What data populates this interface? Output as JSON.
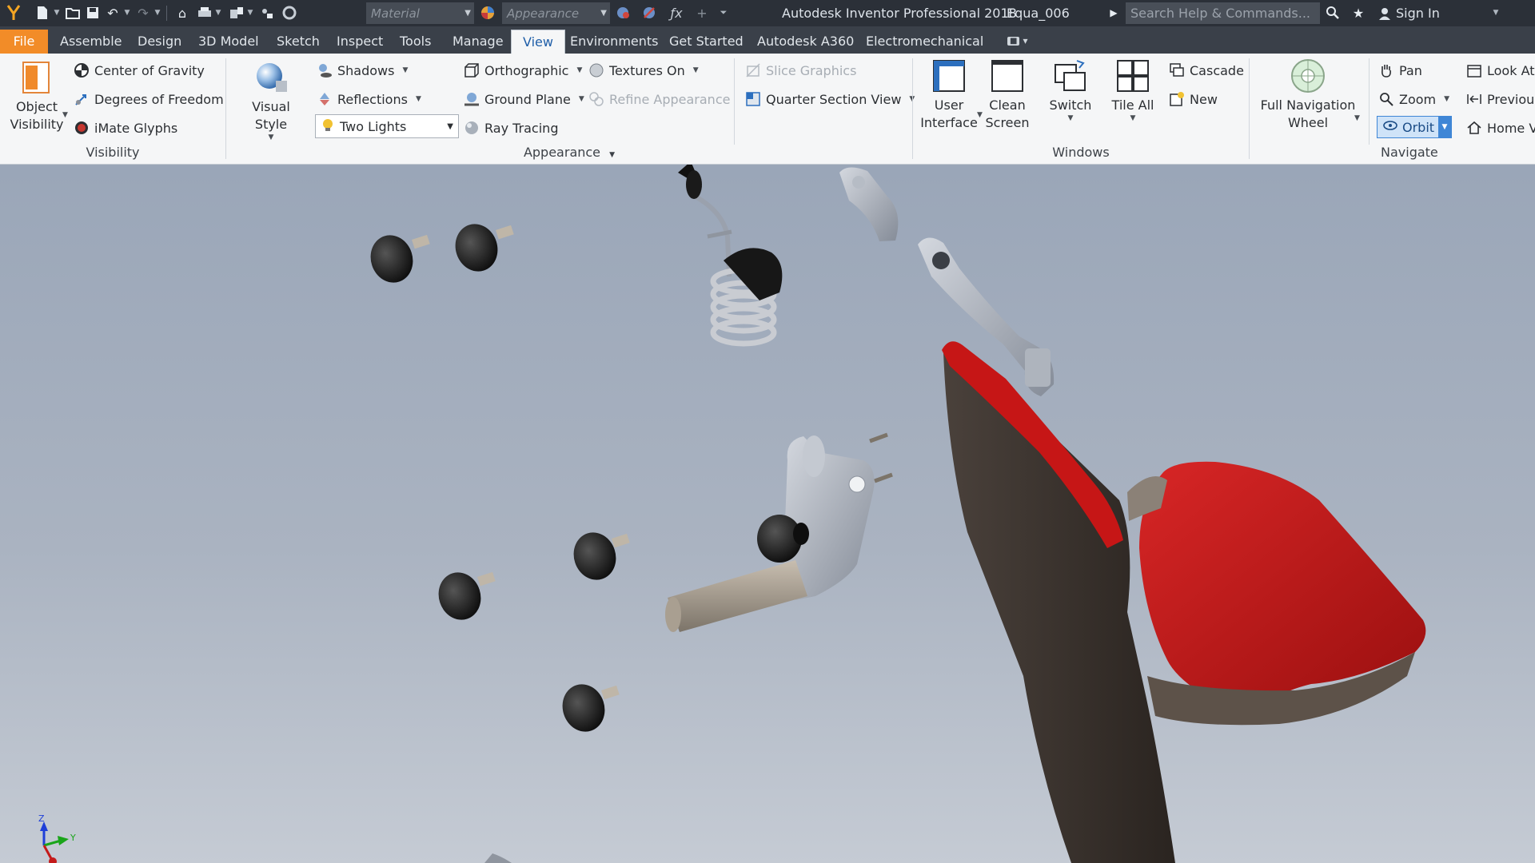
{
  "titlebar": {
    "app_title": "Autodesk Inventor Professional 2018",
    "document": "Equa_006",
    "material_placeholder": "Material",
    "appearance_placeholder": "Appearance",
    "search_placeholder": "Search Help & Commands...",
    "sign_in": "Sign In"
  },
  "tabs": [
    "File",
    "Assemble",
    "Design",
    "3D Model",
    "Sketch",
    "Inspect",
    "Tools",
    "Manage",
    "View",
    "Environments",
    "Get Started",
    "Autodesk A360",
    "Electromechanical"
  ],
  "active_tab": "View",
  "ribbon": {
    "visibility": {
      "title": "Visibility",
      "object_visibility": [
        "Object",
        "Visibility"
      ],
      "center_of_gravity": "Center of Gravity",
      "degrees_of_freedom": "Degrees of Freedom",
      "imate_glyphs": "iMate Glyphs"
    },
    "appearance": {
      "title": "Appearance",
      "visual_style": "Visual Style",
      "shadows": "Shadows",
      "reflections": "Reflections",
      "lighting": "Two Lights",
      "orthographic": "Orthographic",
      "ground_plane": "Ground Plane",
      "ray_tracing": "Ray Tracing",
      "textures_on": "Textures On",
      "refine_appearance": "Refine Appearance",
      "slice_graphics": "Slice Graphics",
      "quarter_section_view": "Quarter Section View"
    },
    "windows": {
      "title": "Windows",
      "user_interface": [
        "User",
        "Interface"
      ],
      "clean_screen": [
        "Clean",
        "Screen"
      ],
      "switch": "Switch",
      "tile_all": "Tile All",
      "cascade": "Cascade",
      "new": "New"
    },
    "navigate": {
      "title": "Navigate",
      "full_navigation_wheel": [
        "Full Navigation",
        "Wheel"
      ],
      "pan": "Pan",
      "zoom": "Zoom",
      "orbit": "Orbit",
      "look_at": "Look At",
      "previous": "Previous",
      "home_view": "Home V"
    }
  },
  "viewport": {
    "triad_z": "Z",
    "triad_y": "Y",
    "colors": {
      "seat_red": "#c41a1a",
      "shell_dark": "#3d3530",
      "part_grey": "#9aa1ad",
      "knob_black": "#141414"
    }
  }
}
